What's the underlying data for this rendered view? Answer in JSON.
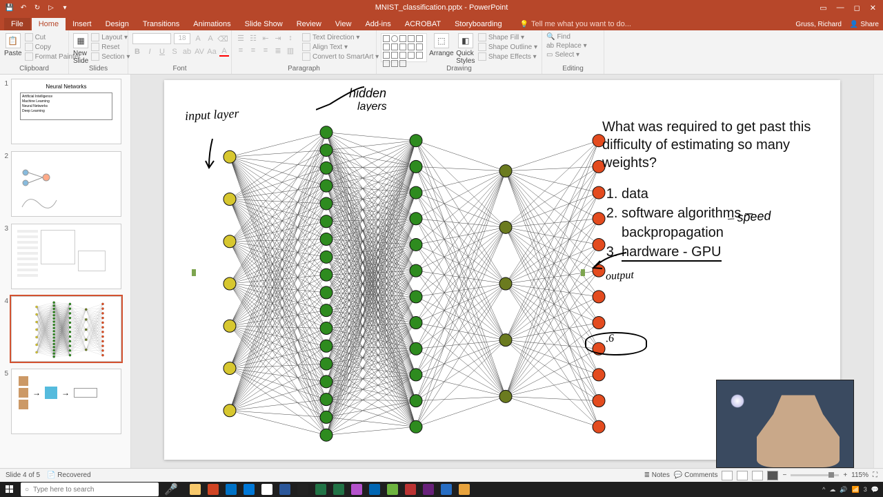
{
  "app": {
    "title": "MNIST_classification.pptx - PowerPoint"
  },
  "window_controls": {
    "restore_down": "🗗",
    "minimize": "—",
    "maximize": "◻",
    "close": "✕",
    "ribbon_opts": "▭"
  },
  "qat": {
    "save": "💾",
    "undo": "↶",
    "redo": "↻",
    "start": "▷",
    "more": "▾"
  },
  "user": {
    "name": "Gruss, Richard",
    "share_label": "Share"
  },
  "tabs": {
    "file": "File",
    "home": "Home",
    "insert": "Insert",
    "design": "Design",
    "transitions": "Transitions",
    "animations": "Animations",
    "slideshow": "Slide Show",
    "review": "Review",
    "view": "View",
    "addins": "Add-ins",
    "acrobat": "ACROBAT",
    "storyboarding": "Storyboarding",
    "tellme": "Tell me what you want to do...",
    "active": "home"
  },
  "ribbon": {
    "clipboard": {
      "label": "Clipboard",
      "paste": "Paste",
      "cut": "Cut",
      "copy": "Copy",
      "format_painter": "Format Painter"
    },
    "slides": {
      "label": "Slides",
      "new_slide": "New\nSlide",
      "layout": "Layout ▾",
      "reset": "Reset",
      "section": "Section ▾"
    },
    "font": {
      "label": "Font",
      "size": "18"
    },
    "paragraph": {
      "label": "Paragraph",
      "text_direction": "Text Direction ▾",
      "align_text": "Align Text ▾",
      "convert": "Convert to SmartArt ▾"
    },
    "drawing": {
      "label": "Drawing",
      "arrange": "Arrange",
      "quick": "Quick\nStyles",
      "shape_fill": "Shape Fill ▾",
      "shape_outline": "Shape Outline ▾",
      "shape_effects": "Shape Effects ▾"
    },
    "editing": {
      "label": "Editing",
      "find": "Find",
      "replace": "Replace ▾",
      "select": "Select ▾"
    }
  },
  "thumbnails": [
    {
      "num": "1",
      "title": "Neural Networks",
      "lines": [
        "Artificial Intelligence",
        "  Machine Learning",
        "    Neural Networks",
        "      Deep Learning"
      ]
    },
    {
      "num": "2"
    },
    {
      "num": "3"
    },
    {
      "num": "4",
      "selected": true
    },
    {
      "num": "5"
    }
  ],
  "slide": {
    "question": "What was required to get past this difficulty of estimating so many weights?",
    "items": [
      "data",
      "software algorithms – backpropagation",
      "hardware - GPU"
    ],
    "ink": {
      "input_layer": "input\nlayer",
      "hidden_layer": "hidden\nlayers",
      "output": "output",
      "speed": "speed",
      "num": ".6"
    },
    "nn_layers": [
      7,
      18,
      12,
      5,
      12
    ]
  },
  "status": {
    "slide_text": "Slide 4 of 5",
    "recovered": "Recovered",
    "notes": "Notes",
    "comments": "Comments",
    "zoom": "115%"
  },
  "taskbar": {
    "search_placeholder": "Type here to search",
    "time": "3",
    "tray_icons": [
      "^",
      "🔊",
      "📶",
      "🔋"
    ],
    "apps": [
      "folder",
      "ppt",
      "outlook",
      "edge",
      "chrome",
      "word",
      "term",
      "excel",
      "xl",
      "paint",
      "wb",
      "sn",
      "cam",
      "vs",
      "r",
      "calc"
    ]
  }
}
